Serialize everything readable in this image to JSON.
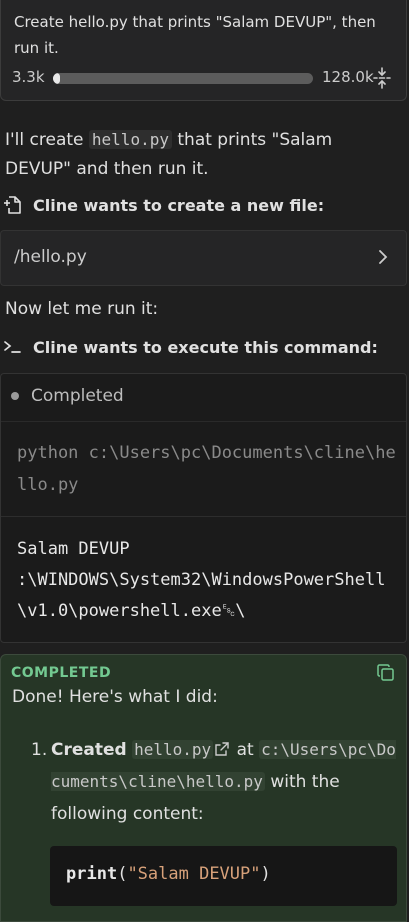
{
  "task": {
    "text": "Create hello.py that prints \"Salam DEVUP\", then run it.",
    "context_used": "3.3k",
    "context_max": "128.0k",
    "context_fraction": 0.026
  },
  "intro": {
    "before": "I'll create ",
    "code": "hello.py",
    "after": " that prints \"Salam DEVUP\" and then run it."
  },
  "create_file": {
    "header": "Cline wants to create a new file:",
    "path": "/hello.py"
  },
  "run_text": "Now let me run it:",
  "execute": {
    "header": "Cline wants to execute this command:",
    "status": "Completed",
    "command": "python c:\\Users\\pc\\Documents\\cline\\hello.py",
    "output": "Salam DEVUP\n:\\WINDOWS\\System32\\WindowsPowerShell\\v1.0\\powershell.exe␛\\"
  },
  "completion": {
    "label": "COMPLETED",
    "intro": "Done! Here's what I did:",
    "item_number": "1.",
    "item_bold": "Created",
    "item_file": "hello.py",
    "item_at": "at",
    "item_path": "c:\\Users\\pc\\Documents\\cline\\hello.py",
    "item_rest": "with the following content:",
    "code_fn": "print",
    "code_open": "(",
    "code_str": "\"Salam DEVUP\"",
    "code_close": ")"
  }
}
